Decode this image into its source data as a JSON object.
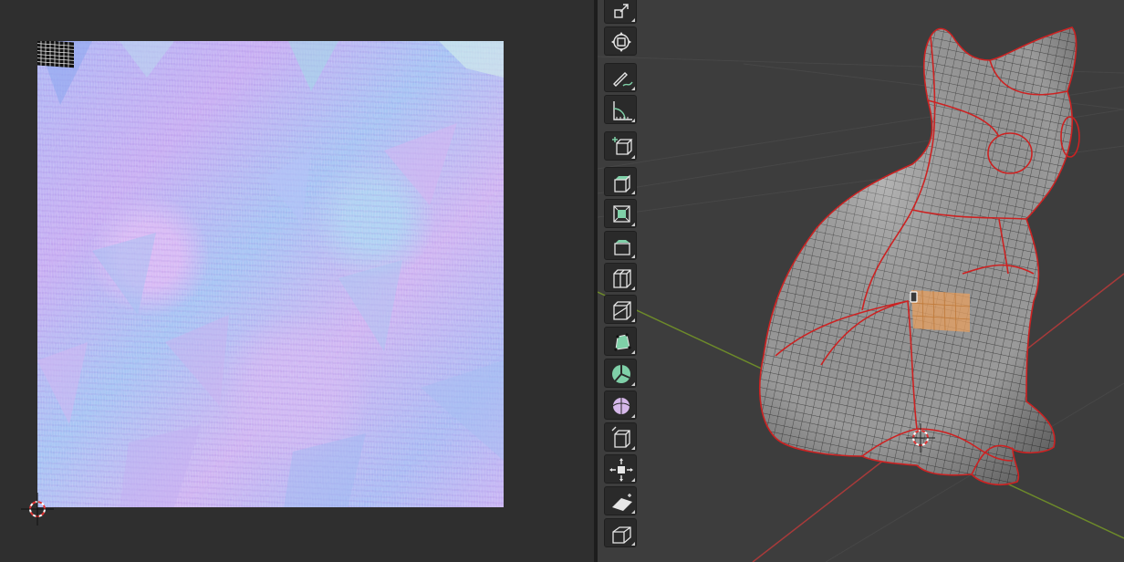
{
  "uv_editor": {
    "texture": "normal-map-bake",
    "island": "uv-island-selected",
    "cursor_icon": "2d-cursor-icon"
  },
  "viewport": {
    "axis_colors": {
      "x": "#a83a3a",
      "y": "#6d8a2a"
    },
    "mesh_edge_color": "#cc2222",
    "selection_color": "#e8a060",
    "object": "cat-mesh",
    "cursor_icon": "3d-cursor-icon"
  },
  "toolbar": {
    "tools": [
      {
        "icon": "scale-icon",
        "active": false
      },
      {
        "icon": "transform-icon",
        "active": false
      },
      {
        "icon": "annotate-icon",
        "active": false
      },
      {
        "icon": "measure-icon",
        "active": false
      },
      {
        "icon": "add-cube-icon",
        "active": false
      },
      {
        "icon": "extrude-region-icon",
        "active": false
      },
      {
        "icon": "inset-faces-icon",
        "active": false
      },
      {
        "icon": "bevel-icon",
        "active": false
      },
      {
        "icon": "loop-cut-icon",
        "active": false
      },
      {
        "icon": "knife-icon",
        "active": false
      },
      {
        "icon": "poly-build-icon",
        "active": false
      },
      {
        "icon": "spin-icon",
        "active": false
      },
      {
        "icon": "smooth-icon",
        "active": false
      },
      {
        "icon": "edge-slide-icon",
        "active": false
      },
      {
        "icon": "shrink-fatten-icon",
        "active": false
      },
      {
        "icon": "shear-icon",
        "active": false
      },
      {
        "icon": "rip-region-icon",
        "active": false
      }
    ]
  }
}
